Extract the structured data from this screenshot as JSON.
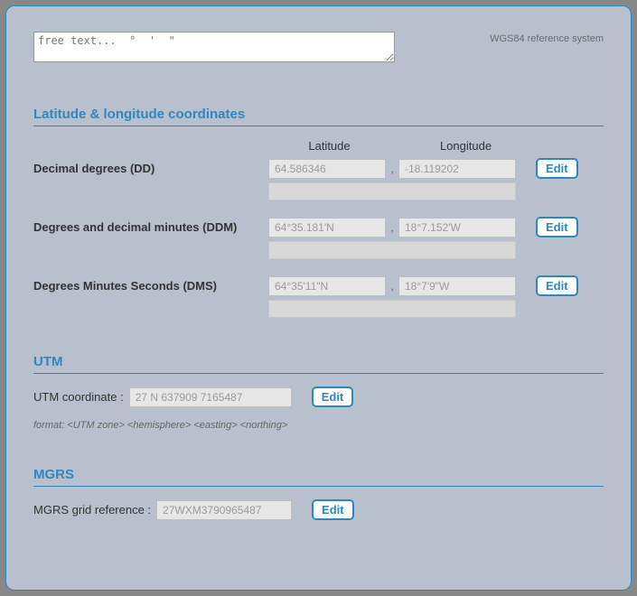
{
  "ref_system": "WGS84 reference system",
  "freetext_placeholder": "free text...  °  '  \"",
  "sections": {
    "latlon": {
      "title": "Latitude & longitude coordinates",
      "col_lat": "Latitude",
      "col_lon": "Longitude",
      "dd": {
        "label": "Decimal degrees (DD)",
        "lat": "64.586346",
        "lon": "-18.119202"
      },
      "ddm": {
        "label": "Degrees and decimal minutes (DDM)",
        "lat": "64°35.181'N",
        "lon": "18°7.152'W"
      },
      "dms": {
        "label": "Degrees Minutes Seconds (DMS)",
        "lat": "64°35'11\"N",
        "lon": "18°7'9\"W"
      }
    },
    "utm": {
      "title": "UTM",
      "label": "UTM coordinate :",
      "value": "27 N 637909 7165487",
      "format": "format: <UTM zone> <hemisphere> <easting> <northing>"
    },
    "mgrs": {
      "title": "MGRS",
      "label": "MGRS grid reference :",
      "value": "27WXM3790965487"
    }
  },
  "buttons": {
    "edit": "Edit"
  },
  "sep": ","
}
